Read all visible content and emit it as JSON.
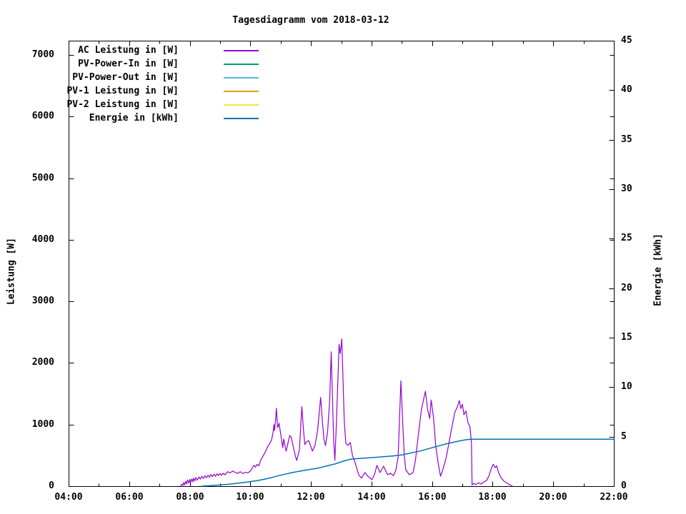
{
  "title": "Tagesdiagramm vom 2018-03-12",
  "chart_data": {
    "type": "line",
    "title": "Tagesdiagramm vom 2018-03-12",
    "grid": false,
    "legend_position": "top-left-inside",
    "x_axis": {
      "unit": "time",
      "min_hour": 4,
      "max_hour": 22,
      "major_tick_step_hours": 2,
      "minor_tick_step_hours": 1,
      "tick_labels": [
        "04:00",
        "06:00",
        "08:00",
        "10:00",
        "12:00",
        "14:00",
        "16:00",
        "18:00",
        "20:00",
        "22:00"
      ]
    },
    "y_left": {
      "label": "Leistung [W]",
      "min": 0,
      "max": 7232,
      "tick_step": 1000,
      "ticks": [
        0,
        1000,
        2000,
        3000,
        4000,
        5000,
        6000,
        7000
      ]
    },
    "y_right": {
      "label": "Energie [kWh]",
      "min": 0,
      "max": 45,
      "tick_step": 5,
      "ticks": [
        0,
        5,
        10,
        15,
        20,
        25,
        30,
        35,
        40,
        45
      ]
    },
    "series": [
      {
        "name": "AC Leistung in [W]",
        "color": "#9400d3",
        "axis": "left",
        "points": [
          [
            7.7,
            0
          ],
          [
            7.73,
            30
          ],
          [
            7.77,
            10
          ],
          [
            7.8,
            60
          ],
          [
            7.83,
            20
          ],
          [
            7.87,
            80
          ],
          [
            7.9,
            35
          ],
          [
            7.93,
            100
          ],
          [
            7.97,
            50
          ],
          [
            8.0,
            110
          ],
          [
            8.03,
            60
          ],
          [
            8.07,
            120
          ],
          [
            8.1,
            70
          ],
          [
            8.13,
            130
          ],
          [
            8.17,
            85
          ],
          [
            8.2,
            140
          ],
          [
            8.25,
            100
          ],
          [
            8.3,
            150
          ],
          [
            8.35,
            115
          ],
          [
            8.4,
            160
          ],
          [
            8.45,
            125
          ],
          [
            8.5,
            170
          ],
          [
            8.55,
            135
          ],
          [
            8.6,
            180
          ],
          [
            8.65,
            145
          ],
          [
            8.7,
            190
          ],
          [
            8.75,
            155
          ],
          [
            8.8,
            195
          ],
          [
            8.85,
            160
          ],
          [
            8.9,
            200
          ],
          [
            8.95,
            170
          ],
          [
            9.0,
            205
          ],
          [
            9.05,
            175
          ],
          [
            9.1,
            210
          ],
          [
            9.17,
            185
          ],
          [
            9.25,
            235
          ],
          [
            9.33,
            215
          ],
          [
            9.42,
            245
          ],
          [
            9.5,
            225
          ],
          [
            9.58,
            205
          ],
          [
            9.67,
            235
          ],
          [
            9.75,
            205
          ],
          [
            9.83,
            225
          ],
          [
            9.92,
            215
          ],
          [
            10.0,
            245
          ],
          [
            10.07,
            300
          ],
          [
            10.12,
            340
          ],
          [
            10.17,
            310
          ],
          [
            10.22,
            355
          ],
          [
            10.28,
            330
          ],
          [
            10.35,
            430
          ],
          [
            10.43,
            500
          ],
          [
            10.5,
            560
          ],
          [
            10.57,
            640
          ],
          [
            10.63,
            684
          ],
          [
            10.7,
            750
          ],
          [
            10.75,
            870
          ],
          [
            10.78,
            1000
          ],
          [
            10.8,
            900
          ],
          [
            10.83,
            1055
          ],
          [
            10.86,
            1264
          ],
          [
            10.9,
            950
          ],
          [
            10.95,
            1020
          ],
          [
            10.98,
            916
          ],
          [
            11.07,
            626
          ],
          [
            11.1,
            765
          ],
          [
            11.18,
            568
          ],
          [
            11.3,
            823
          ],
          [
            11.35,
            790
          ],
          [
            11.48,
            498
          ],
          [
            11.53,
            417
          ],
          [
            11.62,
            590
          ],
          [
            11.7,
            1290
          ],
          [
            11.75,
            940
          ],
          [
            11.8,
            675
          ],
          [
            11.85,
            720
          ],
          [
            11.93,
            740
          ],
          [
            12.0,
            640
          ],
          [
            12.05,
            570
          ],
          [
            12.13,
            650
          ],
          [
            12.22,
            900
          ],
          [
            12.32,
            1440
          ],
          [
            12.38,
            1050
          ],
          [
            12.43,
            760
          ],
          [
            12.48,
            660
          ],
          [
            12.55,
            880
          ],
          [
            12.62,
            1400
          ],
          [
            12.67,
            2180
          ],
          [
            12.71,
            1450
          ],
          [
            12.75,
            750
          ],
          [
            12.79,
            420
          ],
          [
            12.84,
            1000
          ],
          [
            12.89,
            1700
          ],
          [
            12.93,
            2300
          ],
          [
            12.97,
            2150
          ],
          [
            13.02,
            2390
          ],
          [
            13.06,
            1750
          ],
          [
            13.1,
            1080
          ],
          [
            13.15,
            700
          ],
          [
            13.22,
            660
          ],
          [
            13.3,
            710
          ],
          [
            13.37,
            500
          ],
          [
            13.45,
            395
          ],
          [
            13.58,
            180
          ],
          [
            13.67,
            130
          ],
          [
            13.78,
            220
          ],
          [
            13.88,
            160
          ],
          [
            14.02,
            105
          ],
          [
            14.1,
            190
          ],
          [
            14.18,
            337
          ],
          [
            14.28,
            220
          ],
          [
            14.4,
            325
          ],
          [
            14.53,
            185
          ],
          [
            14.63,
            210
          ],
          [
            14.72,
            170
          ],
          [
            14.8,
            250
          ],
          [
            14.88,
            480
          ],
          [
            14.97,
            1710
          ],
          [
            15.03,
            1050
          ],
          [
            15.08,
            500
          ],
          [
            15.13,
            267
          ],
          [
            15.25,
            185
          ],
          [
            15.37,
            220
          ],
          [
            15.45,
            420
          ],
          [
            15.55,
            850
          ],
          [
            15.65,
            1250
          ],
          [
            15.78,
            1540
          ],
          [
            15.85,
            1250
          ],
          [
            15.92,
            1100
          ],
          [
            15.97,
            1400
          ],
          [
            16.05,
            1100
          ],
          [
            16.12,
            650
          ],
          [
            16.2,
            380
          ],
          [
            16.28,
            160
          ],
          [
            16.35,
            260
          ],
          [
            16.45,
            430
          ],
          [
            16.55,
            680
          ],
          [
            16.65,
            950
          ],
          [
            16.75,
            1200
          ],
          [
            16.83,
            1280
          ],
          [
            16.9,
            1390
          ],
          [
            16.95,
            1260
          ],
          [
            17.0,
            1330
          ],
          [
            17.05,
            1160
          ],
          [
            17.12,
            1220
          ],
          [
            17.18,
            1040
          ],
          [
            17.25,
            960
          ],
          [
            17.3,
            700
          ],
          [
            17.32,
            20
          ],
          [
            17.38,
            45
          ],
          [
            17.45,
            25
          ],
          [
            17.53,
            55
          ],
          [
            17.62,
            35
          ],
          [
            17.7,
            65
          ],
          [
            17.8,
            95
          ],
          [
            17.88,
            170
          ],
          [
            17.95,
            280
          ],
          [
            18.02,
            355
          ],
          [
            18.08,
            300
          ],
          [
            18.13,
            330
          ],
          [
            18.2,
            215
          ],
          [
            18.28,
            135
          ],
          [
            18.37,
            85
          ],
          [
            18.45,
            55
          ],
          [
            18.53,
            30
          ],
          [
            18.6,
            15
          ],
          [
            18.65,
            0
          ]
        ]
      },
      {
        "name": "PV-Power-In in [W]",
        "color": "#009e73",
        "axis": "left",
        "points": []
      },
      {
        "name": "PV-Power-Out in [W]",
        "color": "#56b4e9",
        "axis": "left",
        "points": []
      },
      {
        "name": "PV-1 Leistung in [W]",
        "color": "#e69f00",
        "axis": "left",
        "points": []
      },
      {
        "name": "PV-2 Leistung in [W]",
        "color": "#f0e442",
        "axis": "left",
        "points": []
      },
      {
        "name": "Energie in [kWh]",
        "color": "#0072b2",
        "axis": "right",
        "points": [
          [
            8.4,
            0.0
          ],
          [
            8.7,
            0.05
          ],
          [
            9.0,
            0.12
          ],
          [
            9.3,
            0.2
          ],
          [
            9.6,
            0.3
          ],
          [
            9.9,
            0.42
          ],
          [
            10.2,
            0.55
          ],
          [
            10.5,
            0.72
          ],
          [
            10.8,
            0.95
          ],
          [
            11.0,
            1.1
          ],
          [
            11.2,
            1.25
          ],
          [
            11.4,
            1.38
          ],
          [
            11.6,
            1.5
          ],
          [
            11.8,
            1.6
          ],
          [
            12.0,
            1.7
          ],
          [
            12.2,
            1.8
          ],
          [
            12.4,
            1.95
          ],
          [
            12.6,
            2.1
          ],
          [
            12.8,
            2.25
          ],
          [
            13.0,
            2.45
          ],
          [
            13.15,
            2.6
          ],
          [
            13.3,
            2.72
          ],
          [
            13.5,
            2.78
          ],
          [
            13.8,
            2.84
          ],
          [
            14.1,
            2.9
          ],
          [
            14.4,
            2.97
          ],
          [
            14.7,
            3.05
          ],
          [
            15.0,
            3.15
          ],
          [
            15.3,
            3.35
          ],
          [
            15.6,
            3.55
          ],
          [
            15.9,
            3.8
          ],
          [
            16.2,
            4.05
          ],
          [
            16.5,
            4.3
          ],
          [
            16.8,
            4.5
          ],
          [
            17.0,
            4.62
          ],
          [
            17.2,
            4.72
          ],
          [
            17.35,
            4.74
          ],
          [
            18.0,
            4.74
          ],
          [
            19.0,
            4.74
          ],
          [
            20.0,
            4.74
          ],
          [
            21.0,
            4.74
          ],
          [
            22.0,
            4.74
          ]
        ]
      }
    ]
  },
  "legend": {
    "items": [
      {
        "label": "AC Leistung in [W]",
        "color": "#9400d3"
      },
      {
        "label": "PV-Power-In in [W]",
        "color": "#009e73"
      },
      {
        "label": "PV-Power-Out in [W]",
        "color": "#56b4e9"
      },
      {
        "label": "PV-1 Leistung in [W]",
        "color": "#e69f00"
      },
      {
        "label": "PV-2 Leistung in [W]",
        "color": "#f0e442"
      },
      {
        "label": "Energie in [kWh]",
        "color": "#0072b2"
      }
    ]
  },
  "colors": {
    "background": "#ffffff",
    "axis": "#000000",
    "text": "#000000"
  }
}
